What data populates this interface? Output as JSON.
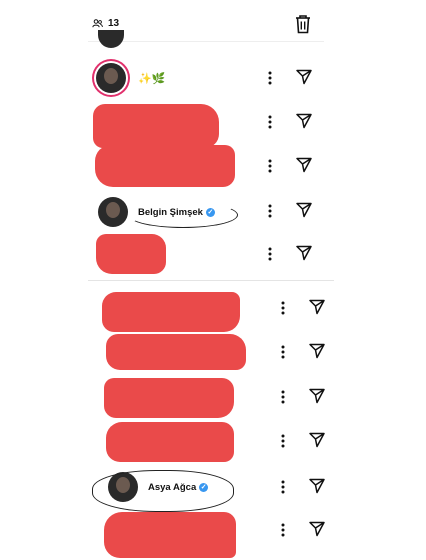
{
  "header": {
    "viewer_count": "13"
  },
  "icons": {
    "viewers": "people-icon",
    "delete": "trash-icon",
    "more": "more-vertical-icon",
    "send": "send-icon"
  },
  "colors": {
    "redaction": "#ea4a4a",
    "verified": "#3897f0",
    "story_ring": "#e1306c"
  },
  "viewers": [
    {
      "name": "",
      "emoji": "",
      "verified": false
    },
    {
      "name": "",
      "emoji": "✨🌿",
      "verified": false
    },
    {
      "name": "",
      "emoji": "",
      "verified": false,
      "redacted": true
    },
    {
      "name": "",
      "emoji": "",
      "verified": false,
      "redacted": true
    },
    {
      "name": "Belgin Şimşek",
      "emoji": "",
      "verified": true
    },
    {
      "name": "",
      "emoji": "",
      "verified": false,
      "redacted": true
    },
    {
      "name": "",
      "emoji": "",
      "verified": false,
      "redacted": true
    },
    {
      "name": "",
      "emoji": "",
      "verified": false,
      "redacted": true
    },
    {
      "name": "",
      "emoji": "",
      "verified": false,
      "redacted": true
    },
    {
      "name": "",
      "emoji": "",
      "verified": false,
      "redacted": true
    },
    {
      "name": "Asya Ağca",
      "emoji": "",
      "verified": true
    },
    {
      "name": "",
      "emoji": "",
      "verified": false,
      "redacted": true
    }
  ]
}
